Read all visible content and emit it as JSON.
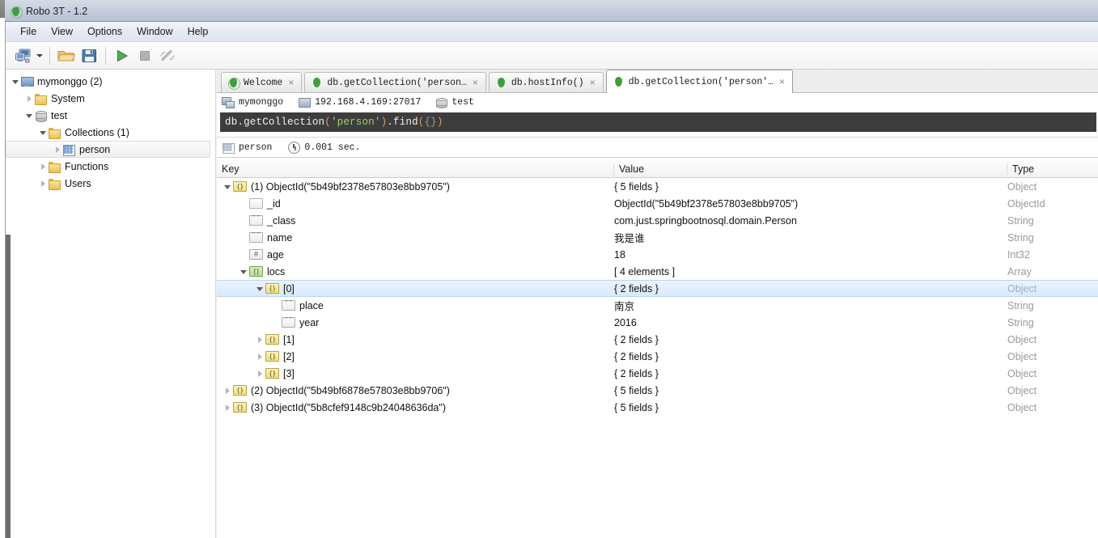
{
  "window": {
    "title": "Robo 3T - 1.2",
    "app_icon": "leaf-icon"
  },
  "menubar": {
    "items": [
      "File",
      "View",
      "Options",
      "Window",
      "Help"
    ]
  },
  "toolbar": {
    "buttons": [
      {
        "name": "connect-button",
        "icon": "computers-icon",
        "title": "Connect"
      },
      {
        "name": "connect-dropdown",
        "icon": "chevron-down-icon",
        "title": "Connect list"
      },
      {
        "name": "open-script-button",
        "icon": "folder-open-icon",
        "title": "Open Script"
      },
      {
        "name": "save-script-button",
        "icon": "floppy-disk-icon",
        "title": "Save Script"
      },
      {
        "name": "execute-button",
        "icon": "play-icon",
        "title": "Execute"
      },
      {
        "name": "stop-button",
        "icon": "stop-square-icon",
        "title": "Stop"
      },
      {
        "name": "refresh-button",
        "icon": "rotate-icon",
        "title": "Refresh"
      }
    ]
  },
  "sidebar": {
    "tree": [
      {
        "label": "mymonggo (2)",
        "icon": "computer-icon",
        "depth": 0,
        "state": "open",
        "selected": false
      },
      {
        "label": "System",
        "icon": "folder-icon",
        "depth": 1,
        "state": "closed",
        "selected": false
      },
      {
        "label": "test",
        "icon": "database-icon",
        "depth": 1,
        "state": "open",
        "selected": false
      },
      {
        "label": "Collections (1)",
        "icon": "folder-icon",
        "depth": 2,
        "state": "open",
        "selected": false
      },
      {
        "label": "person",
        "icon": "grid-icon",
        "depth": 3,
        "state": "closed",
        "selected": true
      },
      {
        "label": "Functions",
        "icon": "folder-icon",
        "depth": 2,
        "state": "closed",
        "selected": false
      },
      {
        "label": "Users",
        "icon": "folder-icon",
        "depth": 2,
        "state": "closed",
        "selected": false
      }
    ]
  },
  "tabs": [
    {
      "label": "Welcome",
      "icon": "leaf-ring-icon",
      "active": false,
      "close": "×"
    },
    {
      "label": "db.getCollection('person…",
      "icon": "leaf-icon",
      "active": false,
      "close": "×"
    },
    {
      "label": "db.hostInfo()",
      "icon": "leaf-icon",
      "active": false,
      "close": "×"
    },
    {
      "label": "db.getCollection('person'…",
      "icon": "leaf-icon",
      "active": true,
      "close": "×"
    }
  ],
  "connection_bar": {
    "server": "mymonggo",
    "host": "192.168.4.169:27017",
    "database": "test"
  },
  "editor": {
    "tokens": [
      {
        "text": "db.getCollection",
        "type": "plain"
      },
      {
        "text": "(",
        "type": "punct"
      },
      {
        "text": "'person'",
        "type": "str"
      },
      {
        "text": ")",
        "type": "punct"
      },
      {
        "text": ".find",
        "type": "plain"
      },
      {
        "text": "(",
        "type": "punct"
      },
      {
        "text": "{}",
        "type": "brace"
      },
      {
        "text": ")",
        "type": "punct"
      }
    ],
    "plain_text": "db.getCollection('person').find({})"
  },
  "result_bar": {
    "collection": "person",
    "time": "0.001 sec."
  },
  "grid": {
    "columns": [
      "Key",
      "Value",
      "Type"
    ],
    "rows": [
      {
        "depth": 0,
        "state": "open",
        "icon": "doc",
        "key": "(1) ObjectId(\"5b49bf2378e57803e8bb9705\")",
        "value": "{ 5 fields }",
        "type": "Object",
        "selected": false
      },
      {
        "depth": 1,
        "state": "none",
        "icon": "oid",
        "key": "_id",
        "value": "ObjectId(\"5b49bf2378e57803e8bb9705\")",
        "type": "ObjectId",
        "selected": false
      },
      {
        "depth": 1,
        "state": "none",
        "icon": "str",
        "key": "_class",
        "value": "com.just.springbootnosql.domain.Person",
        "type": "String",
        "selected": false
      },
      {
        "depth": 1,
        "state": "none",
        "icon": "str",
        "key": "name",
        "value": "我是谁",
        "type": "String",
        "selected": false
      },
      {
        "depth": 1,
        "state": "none",
        "icon": "num",
        "key": "age",
        "value": "18",
        "type": "Int32",
        "selected": false
      },
      {
        "depth": 1,
        "state": "open",
        "icon": "arr",
        "key": "locs",
        "value": "[ 4 elements ]",
        "type": "Array",
        "selected": false
      },
      {
        "depth": 2,
        "state": "open",
        "icon": "doc",
        "key": "[0]",
        "value": "{ 2 fields }",
        "type": "Object",
        "selected": true
      },
      {
        "depth": 3,
        "state": "none",
        "icon": "str",
        "key": "place",
        "value": "南京",
        "type": "String",
        "selected": false
      },
      {
        "depth": 3,
        "state": "none",
        "icon": "str",
        "key": "year",
        "value": "2016",
        "type": "String",
        "selected": false
      },
      {
        "depth": 2,
        "state": "closed",
        "icon": "doc",
        "key": "[1]",
        "value": "{ 2 fields }",
        "type": "Object",
        "selected": false
      },
      {
        "depth": 2,
        "state": "closed",
        "icon": "doc",
        "key": "[2]",
        "value": "{ 2 fields }",
        "type": "Object",
        "selected": false
      },
      {
        "depth": 2,
        "state": "closed",
        "icon": "doc",
        "key": "[3]",
        "value": "{ 2 fields }",
        "type": "Object",
        "selected": false
      },
      {
        "depth": 0,
        "state": "closed",
        "icon": "doc",
        "key": "(2) ObjectId(\"5b49bf6878e57803e8bb9706\")",
        "value": "{ 5 fields }",
        "type": "Object",
        "selected": false
      },
      {
        "depth": 0,
        "state": "closed",
        "icon": "doc",
        "key": "(3) ObjectId(\"5b8cfef9148c9b24048636da\")",
        "value": "{ 5 fields }",
        "type": "Object",
        "selected": false
      }
    ]
  },
  "colors": {
    "accent_green": "#3aa03a",
    "selection_blue": "#d8eafb",
    "editor_bg": "#3d3d3d",
    "string_token": "#9ad26a",
    "punct_token": "#d9a05b"
  }
}
